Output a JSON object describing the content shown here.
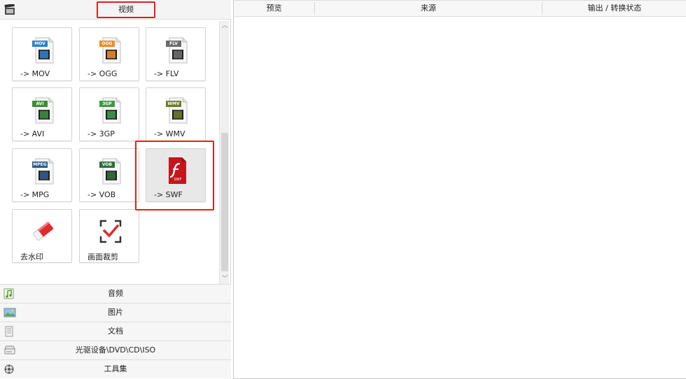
{
  "left_panel": {
    "video_category": "视频",
    "formats": [
      {
        "label": "-> MOV",
        "icon": "mov-file-icon",
        "badge": "MOV",
        "color": "#2f7fc9"
      },
      {
        "label": "-> OGG",
        "icon": "ogg-file-icon",
        "badge": "OGG",
        "color": "#ef8a2a"
      },
      {
        "label": "-> FLV",
        "icon": "flv-file-icon",
        "badge": "FLV",
        "color": "#6d6d6d"
      },
      {
        "label": "-> AVI",
        "icon": "avi-file-icon",
        "badge": "AVI",
        "color": "#3a8f3a"
      },
      {
        "label": "-> 3GP",
        "icon": "3gp-file-icon",
        "badge": "3GP",
        "color": "#3c9a46"
      },
      {
        "label": "-> WMV",
        "icon": "wmv-file-icon",
        "badge": "WMV",
        "color": "#6e7a26"
      },
      {
        "label": "-> MPG",
        "icon": "mpg-file-icon",
        "badge": "MPEG",
        "color": "#2c5a8c"
      },
      {
        "label": "-> VOB",
        "icon": "vob-file-icon",
        "badge": "VOB",
        "color": "#2f6f3a"
      },
      {
        "label": "-> SWF",
        "icon": "swf-file-icon",
        "badge": "SWF",
        "color": "#c4161c"
      },
      {
        "label": "去水印",
        "icon": "eraser-icon",
        "badge": "",
        "color": "#d8262d"
      },
      {
        "label": "画面裁剪",
        "icon": "crop-icon",
        "badge": "",
        "color": "#d8262d"
      }
    ],
    "categories": [
      {
        "label": "音频",
        "icon": "music-note-icon"
      },
      {
        "label": "图片",
        "icon": "picture-icon"
      },
      {
        "label": "文档",
        "icon": "document-icon"
      },
      {
        "label": "光驱设备\\DVD\\CD\\ISO",
        "icon": "disc-drive-icon"
      },
      {
        "label": "工具集",
        "icon": "tools-icon"
      }
    ]
  },
  "right_panel": {
    "columns": [
      "预览",
      "来源",
      "输出 / 转换状态"
    ]
  }
}
